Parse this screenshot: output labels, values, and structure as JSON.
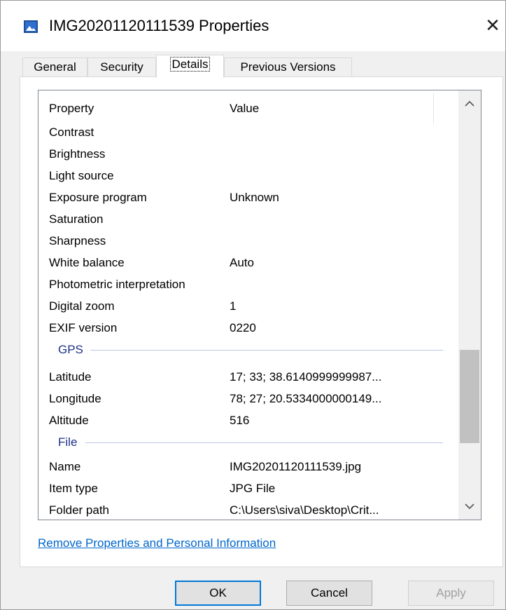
{
  "window": {
    "title": "IMG20201120111539 Properties",
    "close_glyph": "✕"
  },
  "tabs": [
    {
      "label": "General"
    },
    {
      "label": "Security"
    },
    {
      "label": "Details",
      "active": true
    },
    {
      "label": "Previous Versions"
    }
  ],
  "details": {
    "header_property": "Property",
    "header_value": "Value",
    "rows_top": [
      {
        "property": "Contrast",
        "value": ""
      },
      {
        "property": "Brightness",
        "value": ""
      },
      {
        "property": "Light source",
        "value": ""
      },
      {
        "property": "Exposure program",
        "value": "Unknown"
      },
      {
        "property": "Saturation",
        "value": ""
      },
      {
        "property": "Sharpness",
        "value": ""
      },
      {
        "property": "White balance",
        "value": "Auto"
      },
      {
        "property": "Photometric interpretation",
        "value": ""
      },
      {
        "property": "Digital zoom",
        "value": "1"
      },
      {
        "property": "EXIF version",
        "value": "0220"
      }
    ],
    "gps_group": "GPS",
    "rows_gps": [
      {
        "property": "Latitude",
        "value": "17; 33; 38.6140999999987..."
      },
      {
        "property": "Longitude",
        "value": "78; 27; 20.5334000000149..."
      },
      {
        "property": "Altitude",
        "value": "516"
      }
    ],
    "file_group": "File",
    "rows_file": [
      {
        "property": "Name",
        "value": "IMG20201120111539.jpg"
      },
      {
        "property": "Item type",
        "value": "JPG File"
      },
      {
        "property": "Folder path",
        "value": "C:\\Users\\siva\\Desktop\\Crit..."
      }
    ]
  },
  "scrollbar": {
    "up_glyph": "^",
    "down_glyph": "v"
  },
  "link_text": "Remove Properties and Personal Information",
  "buttons": {
    "ok": "OK",
    "cancel": "Cancel",
    "apply": "Apply"
  }
}
